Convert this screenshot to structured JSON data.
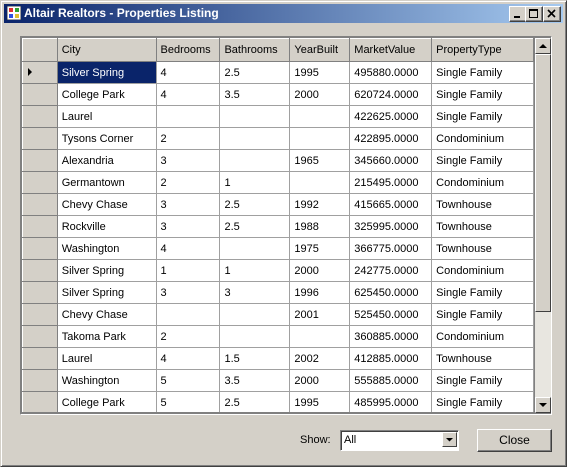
{
  "window": {
    "title": "Altair Realtors - Properties Listing"
  },
  "grid": {
    "columns": [
      "City",
      "Bedrooms",
      "Bathrooms",
      "YearBuilt",
      "MarketValue",
      "PropertyType"
    ],
    "rows": [
      [
        "Silver Spring",
        "4",
        "2.5",
        "1995",
        "495880.0000",
        "Single Family"
      ],
      [
        "College Park",
        "4",
        "3.5",
        "2000",
        "620724.0000",
        "Single Family"
      ],
      [
        "Laurel",
        "",
        "",
        "",
        "422625.0000",
        "Single Family"
      ],
      [
        "Tysons Corner",
        "2",
        "",
        "",
        "422895.0000",
        "Condominium"
      ],
      [
        "Alexandria",
        "3",
        "",
        "1965",
        "345660.0000",
        "Single Family"
      ],
      [
        "Germantown",
        "2",
        "1",
        "",
        "215495.0000",
        "Condominium"
      ],
      [
        "Chevy Chase",
        "3",
        "2.5",
        "1992",
        "415665.0000",
        "Townhouse"
      ],
      [
        "Rockville",
        "3",
        "2.5",
        "1988",
        "325995.0000",
        "Townhouse"
      ],
      [
        "Washington",
        "4",
        "",
        "1975",
        "366775.0000",
        "Townhouse"
      ],
      [
        "Silver Spring",
        "1",
        "1",
        "2000",
        "242775.0000",
        "Condominium"
      ],
      [
        "Silver Spring",
        "3",
        "3",
        "1996",
        "625450.0000",
        "Single Family"
      ],
      [
        "Chevy Chase",
        "",
        "",
        "2001",
        "525450.0000",
        "Single Family"
      ],
      [
        "Takoma Park",
        "2",
        "",
        "",
        "360885.0000",
        "Condominium"
      ],
      [
        "Laurel",
        "4",
        "1.5",
        "2002",
        "412885.0000",
        "Townhouse"
      ],
      [
        "Washington",
        "5",
        "3.5",
        "2000",
        "555885.0000",
        "Single Family"
      ],
      [
        "College Park",
        "5",
        "2.5",
        "1995",
        "485995.0000",
        "Single Family"
      ]
    ]
  },
  "footer": {
    "show_label": "Show:",
    "show_value": "All",
    "close_label": "Close"
  }
}
